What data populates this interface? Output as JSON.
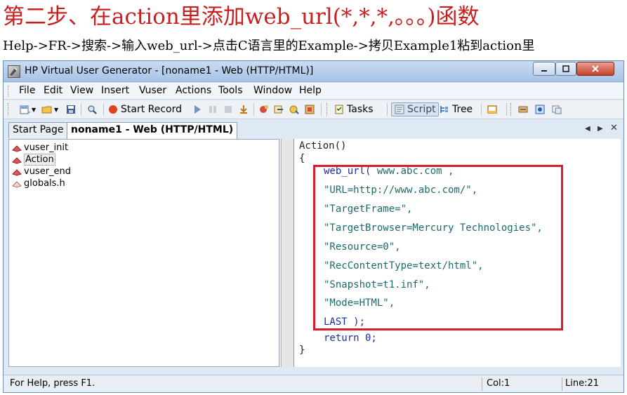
{
  "heading": "第二步、在action里添加web_url(*,*,*,。。。)函数",
  "subheading": "Help->FR->搜索->输入web_url->点击C语言里的Example->拷贝Example1粘到action里",
  "window": {
    "title": "HP Virtual User Generator - [noname1 - Web (HTTP/HTML)]"
  },
  "menu": [
    "File",
    "Edit",
    "View",
    "Insert",
    "Vuser",
    "Actions",
    "Tools",
    "Window",
    "Help"
  ],
  "toolbar": {
    "start_record": "Start Record",
    "tasks": "Tasks",
    "script": "Script",
    "tree": "Tree"
  },
  "tabs": [
    "Start Page",
    "noname1 - Web (HTTP/HTML)"
  ],
  "tree_items": [
    "vuser_init",
    "Action",
    "vuser_end",
    "globals.h"
  ],
  "code": {
    "l1": "Action()",
    "l2": "{",
    "l3_fn": "web_url(",
    "l3_arg": " www.abc.com ,",
    "l4": "\"URL=http://www.abc.com/\",",
    "l5": "\"TargetFrame=\",",
    "l6": "\"TargetBrowser=Mercury Technologies\",",
    "l7": "\"Resource=0\",",
    "l8": "\"RecContentType=text/html\",",
    "l9": "\"Snapshot=t1.inf\",",
    "l10": "\"Mode=HTML\",",
    "l11": "LAST );",
    "l12": "return 0;",
    "l13": "}"
  },
  "status": {
    "help": "For Help, press F1.",
    "col": "Col:1",
    "line": "Line:21"
  },
  "colors": {
    "heading": "#c81e1e",
    "highlight_box": "#d41e2a",
    "keyword": "#1a2ea3",
    "string": "#1d6a6a"
  }
}
